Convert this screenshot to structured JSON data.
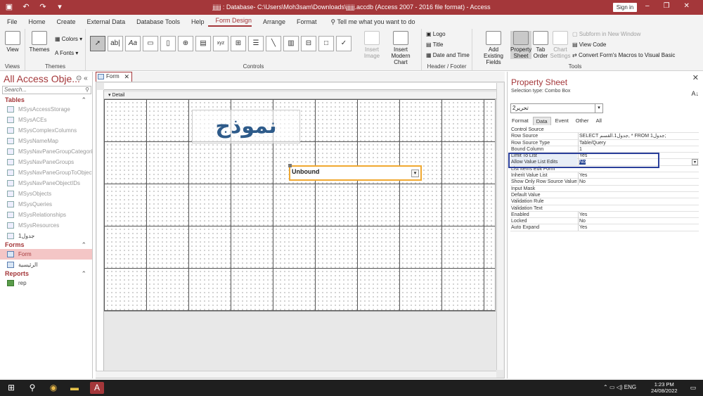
{
  "window": {
    "title": "jjjjjj : Database- C:\\Users\\Moh3sam\\Downloads\\jjjjjj.accdb (Access 2007 - 2016 file format) - Access",
    "sign_in": "Sign in",
    "minimize": "–",
    "restore": "❐",
    "close": "✕",
    "accent": "#a4373a"
  },
  "ribbon_tabs": [
    "File",
    "Home",
    "Create",
    "External Data",
    "Database Tools",
    "Help",
    "Form Design",
    "Arrange",
    "Format"
  ],
  "active_tab": "Form Design",
  "tell_me": "Tell me what you want to do",
  "ribbon": {
    "views": {
      "view": "View",
      "group": "Views"
    },
    "themes": {
      "themes": "Themes",
      "colors": "Colors",
      "fonts": "Fonts",
      "group": "Themes"
    },
    "controls": {
      "insert_image": "Insert Image",
      "insert_modern_chart": "Insert Modern Chart",
      "group": "Controls"
    },
    "header_footer": {
      "logo": "Logo",
      "title": "Title",
      "date_time": "Date and Time",
      "group": "Header / Footer"
    },
    "tools": {
      "add_existing_fields": "Add Existing Fields",
      "property_sheet": "Property Sheet",
      "tab_order": "Tab Order",
      "chart_settings": "Chart Settings",
      "subform": "Subform in New Window",
      "view_code": "View Code",
      "convert_macros": "Convert Form's Macros to Visual Basic",
      "group": "Tools"
    }
  },
  "nav": {
    "title": "All Access Obje...",
    "search_placeholder": "Search...",
    "tables_header": "Tables",
    "tables": [
      "MSysAccessStorage",
      "MSysACEs",
      "MSysComplexColumns",
      "MSysNameMap",
      "MSysNavPaneGroupCategories",
      "MSysNavPaneGroups",
      "MSysNavPaneGroupToObjects",
      "MSysNavPaneObjectIDs",
      "MSysObjects",
      "MSysQueries",
      "MSysRelationships",
      "MSysResources"
    ],
    "user_table": "جدول1",
    "forms_header": "Forms",
    "forms": [
      "Form",
      "الرئيسية"
    ],
    "reports_header": "Reports",
    "reports": [
      "rep"
    ]
  },
  "doc": {
    "tab_label": "Form",
    "section": "Detail",
    "label_text": "نموذج",
    "combo_value": "Unbound"
  },
  "property_sheet": {
    "title": "Property Sheet",
    "selection_type": "Selection type:  Combo Box",
    "selected_control": "تحرير2",
    "tabs": [
      "Format",
      "Data",
      "Event",
      "Other",
      "All"
    ],
    "active_tab": "Data",
    "rows": [
      {
        "key": "Control Source",
        "value": ""
      },
      {
        "key": "Row Source",
        "value": "SELECT جدول1.القسم, * FROM جدول1;"
      },
      {
        "key": "Row Source Type",
        "value": "Table/Query"
      },
      {
        "key": "Bound Column",
        "value": "1"
      },
      {
        "key": "Limit To List",
        "value": "Yes"
      },
      {
        "key": "Allow Value List Edits",
        "value": "No"
      },
      {
        "key": "List Items Edit Form",
        "value": ""
      },
      {
        "key": "Inherit Value List",
        "value": "Yes"
      },
      {
        "key": "Show Only Row Source Values",
        "value": "No"
      },
      {
        "key": "Input Mask",
        "value": ""
      },
      {
        "key": "Default Value",
        "value": ""
      },
      {
        "key": "Validation Rule",
        "value": ""
      },
      {
        "key": "Validation Text",
        "value": ""
      },
      {
        "key": "Enabled",
        "value": "Yes"
      },
      {
        "key": "Locked",
        "value": "No"
      },
      {
        "key": "Auto Expand",
        "value": "Yes"
      }
    ]
  },
  "taskbar": {
    "language": "ENG",
    "time": "1:23 PM",
    "date": "24/08/2022"
  }
}
